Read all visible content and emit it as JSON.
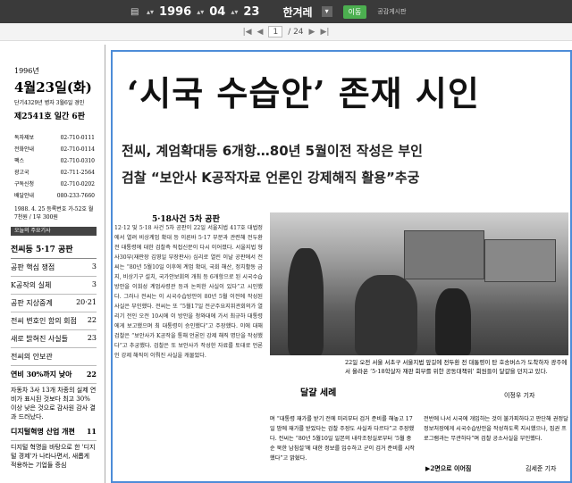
{
  "topbar": {
    "menu_icon": "grid-menu-icon",
    "year": "1996",
    "month": "04",
    "day": "23",
    "paper": "한겨레",
    "go_label": "이동",
    "link_label": "공감게시판"
  },
  "pager": {
    "current": "1",
    "total": "/ 24"
  },
  "sidebar": {
    "year": "1996년",
    "date": "4월23일(화)",
    "lunar": "단기4329년 병자 3월6일 경인",
    "issue": "제2541호 일간 6판",
    "contacts": [
      {
        "label": "독자제보",
        "value": "02-710-0111"
      },
      {
        "label": "전화안내",
        "value": "02-710-0114"
      },
      {
        "label": "팩스",
        "value": "02-710-0310"
      },
      {
        "label": "광고국",
        "value": "02-711-2564"
      },
      {
        "label": "구독신청",
        "value": "02-710-0202"
      },
      {
        "label": "배달안내",
        "value": "080-233-7660"
      }
    ],
    "note": "1988. 4. 25 등록번호 가-52호 월 7천원 / 1부 300원",
    "section_head": "오늘의 주요기사",
    "toc_head": "전씨등 5·17 공판",
    "toc": [
      {
        "label": "공판 핵심 쟁점",
        "page": "3"
      },
      {
        "label": "K공작의 실체",
        "page": "3"
      },
      {
        "label": "공판 지상중계",
        "page": "20·21"
      },
      {
        "label": "전씨 변호인 함의 회점",
        "page": "22"
      },
      {
        "label": "새로 밝혀진 사실들",
        "page": "23"
      },
      {
        "label": "전씨의 안보관",
        "page": ""
      }
    ],
    "bold_item": {
      "label": "연비 30%까지 낮아",
      "page": "22"
    },
    "bold_para": "자동차 3사 13개 차종의 실제 연비가 표시된 것보다 최고 30% 이상 낮은 것으로 감사원 감사 결과 드러났다.",
    "bold_item2": {
      "label": "디지털혁명 산업 개편",
      "page": "11"
    },
    "bold_para2": "디지털 혁명을 바탕으로 한 '디지털 경제'가 나타나면서, 새롭게 적용하는 기업들 증심"
  },
  "article": {
    "headline": "‘시국 수습안’ 존재 시인",
    "sub1": "전씨, 계엄확대등 6개항…80년 5월이전 작성은 부인",
    "sub2": "검찰 “보안사 K공작자료 언론인 강제해직 활용”추궁",
    "col_head": "5·18사건 5차 공판",
    "body": "12·12 및 5·18 사건 5차 공판이 22일 서울지법 417호 대법정에서 열려 비상계엄 확대 등 이른바 5·17 부분과 관련해 전두환 전 대통령에 대한 검찰측 직접신문이 다시 이어졌다. 서울지법 형사30부(재판장 김영일 부장판사) 심리로 열린 이날 공판에서 전씨는 “80년 5월10일 이후에 계엄 확대, 국회 해산, 정치활동 금지, 비상기구 설치, 국가안보회의 개최 등 6개항으로 된 시국수습방안을 이희성 계엄사령관 등과 논의한 사실이 있다”고 시인했다. 그러나 전씨는 이 시국수습방안이 80년 5월 이전에 작성된 사실은 부인했다. 전씨는 또 “5월17일 전군주요지휘관회의가 열리기 전인 오전 10시에 이 방안을 청와대에 가서 최규하 대통령에게 보고했으며 최 대통령이 승인했다”고 주장했다. 이에 대해 검찰은 “보안사가 K공작을 통해 언론인 강제 해직 명단을 작성했다”고 추궁했다. 검찰은 또 보안사가 작성한 자료를 토대로 언론인 강제 해직이 이뤄진 사실을 캐물었다.",
    "caption_title": "달걀 세례",
    "caption_text": "22일 오전 서울 서초구 서울지법 앞길에 전두환 전 대통령이 탄 호송버스가 도착하자 광주에서 올라온 ‘5·18학살자 재판 회부를 위한 공동대책위’ 회원들이 달걀을 던지고 있다.",
    "caption_sign": "이정우 기자",
    "bottom_cols": [
      "며 “대통령 재가를 받기 전에 미리부터 검거 준비를 해놓고 17일 밤에 재가를 받았다는 검찰 주장도 사실과 다르다”고 주장했다. 전씨는 “80년 5월10일 일본의 내각조정실로부터 ‘5월 중순 북한 남침설’에 대한 정보를 입수하고 군이 검거 준비를 시작했다”고 밝혔다.",
      "전반에 나서 시국에 개입하는 것이 불가피하다고 판단해 권정달 정보처장에게 시국수습방안을 작성하도록 지시했으나, 집권 프로그램과는 무관하다”며 검찰 공소사실을 부인했다."
    ],
    "continued": "▶2면으로 이어짐",
    "reporter": "김세준 기자"
  }
}
